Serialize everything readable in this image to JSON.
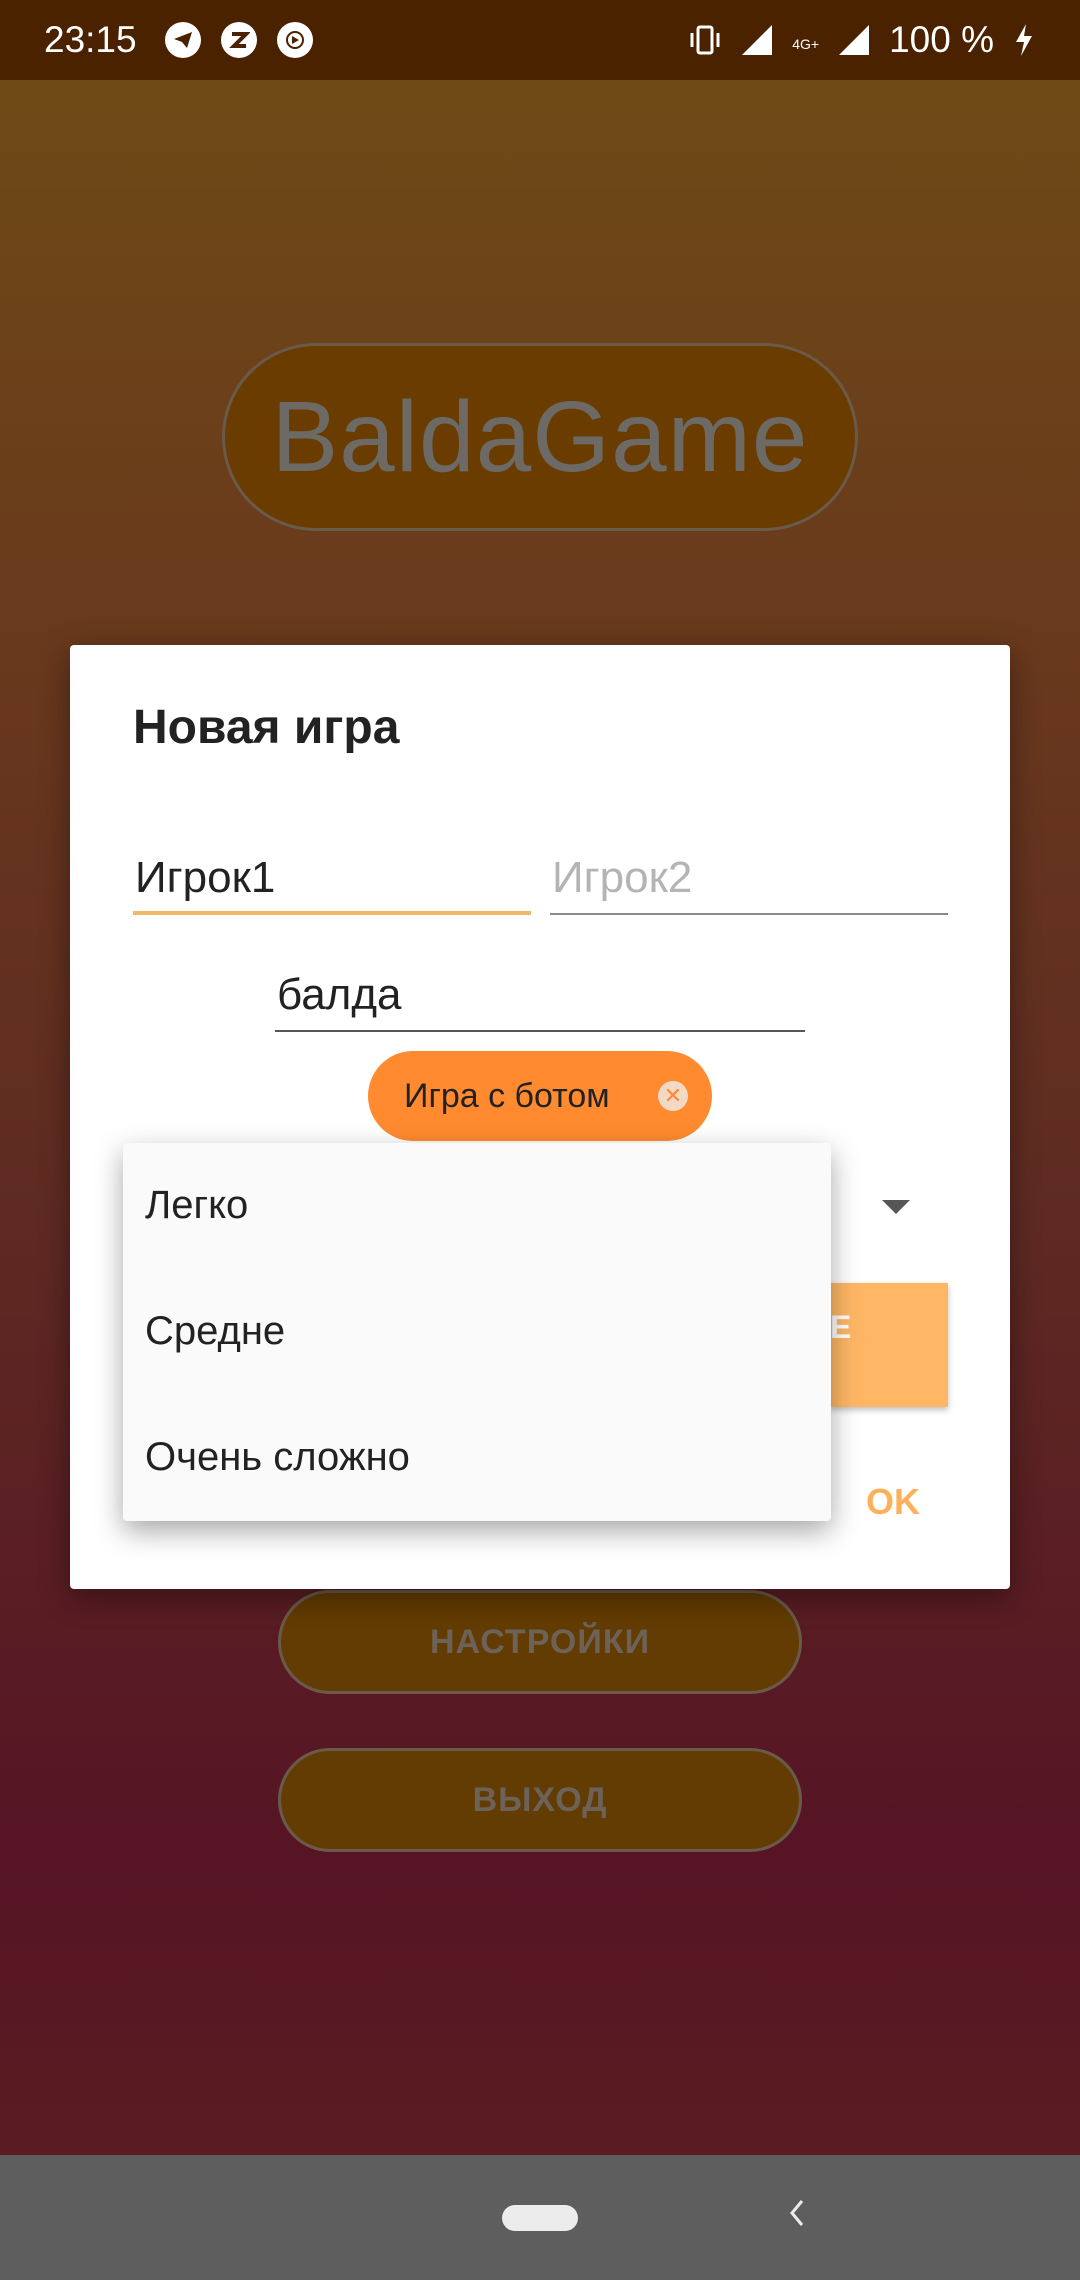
{
  "status_bar": {
    "time": "23:15",
    "battery": "100 %",
    "network": "4G+"
  },
  "background": {
    "app_title": "BaldaGame",
    "menu": {
      "settings_label": "НАСТРОЙКИ",
      "exit_label": "ВЫХОД"
    }
  },
  "dialog": {
    "title": "Новая игра",
    "player1_value": "Игрок1",
    "player2_placeholder": "Игрок2",
    "word_value": "балда",
    "bot_chip_label": "Игра с ботом",
    "partial_button_text": "Е",
    "ok_label": "OK"
  },
  "dropdown": {
    "options": [
      "Легко",
      "Средне",
      "Очень сложно"
    ]
  },
  "colors": {
    "accent": "#ff8a30",
    "accent_light": "#ffb765",
    "field_focus": "#f2b86a",
    "status_bar": "#4a2200"
  }
}
